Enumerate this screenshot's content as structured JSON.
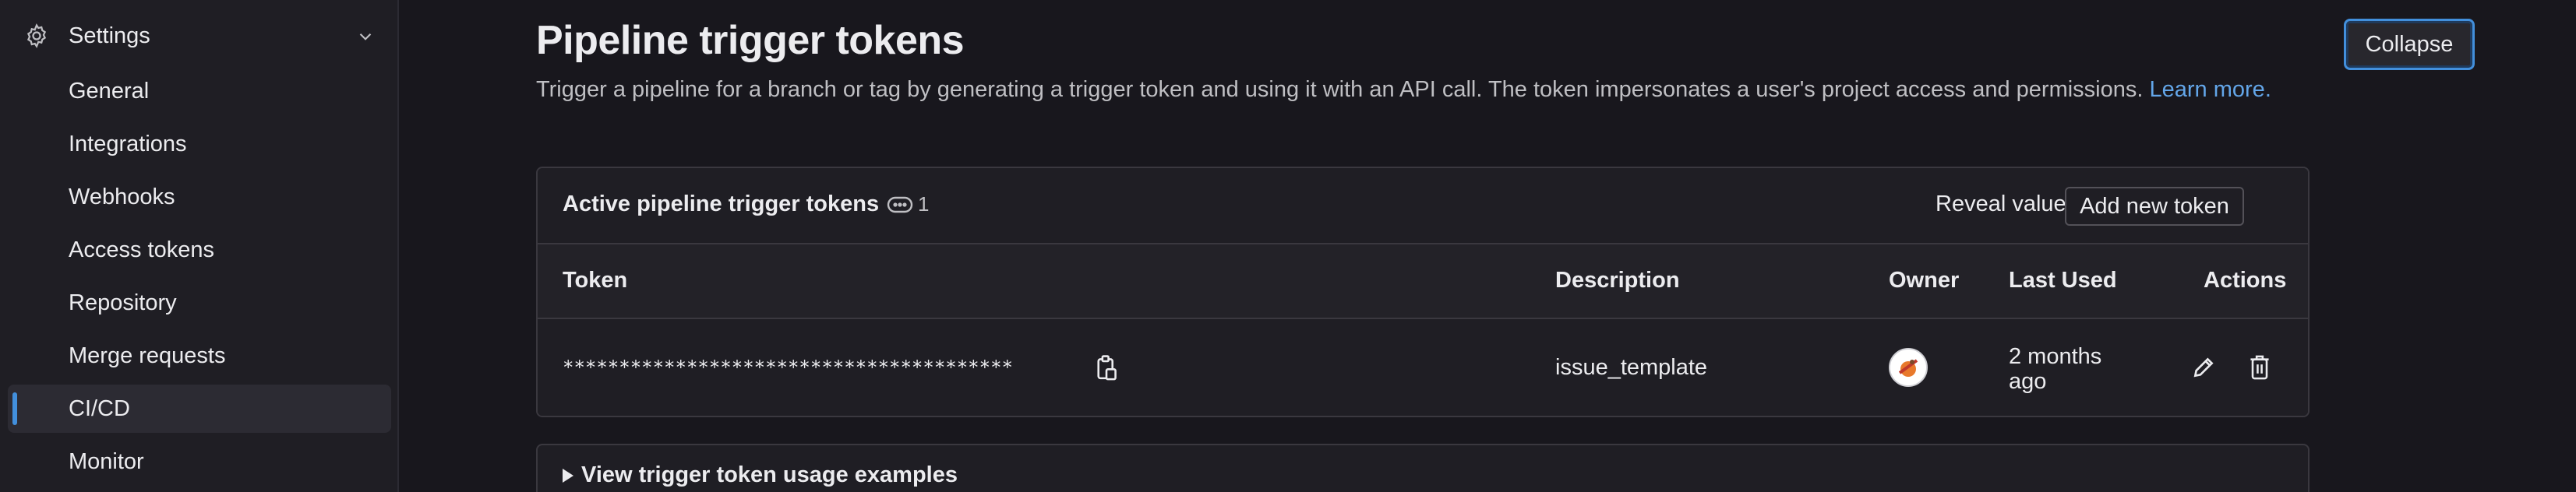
{
  "sidebar": {
    "settings_label": "Settings",
    "items": [
      {
        "label": "General"
      },
      {
        "label": "Integrations"
      },
      {
        "label": "Webhooks"
      },
      {
        "label": "Access tokens"
      },
      {
        "label": "Repository"
      },
      {
        "label": "Merge requests"
      },
      {
        "label": "CI/CD",
        "active": true
      },
      {
        "label": "Monitor"
      }
    ]
  },
  "header": {
    "title": "Pipeline trigger tokens",
    "collapse_label": "Collapse",
    "description": "Trigger a pipeline for a branch or tag by generating a trigger token and using it with an API call. The token impersonates a user's project access and permissions.",
    "learn_more": "Learn more."
  },
  "tokens_card": {
    "title": "Active pipeline trigger tokens",
    "count": "1",
    "reveal_label": "Reveal values",
    "add_label": "Add new token",
    "columns": [
      "Token",
      "Description",
      "Owner",
      "Last Used",
      "Actions"
    ],
    "rows": [
      {
        "token": "****************************************",
        "description": "issue_template",
        "last_used": "2 months ago"
      }
    ]
  },
  "examples": {
    "label": "View trigger token usage examples"
  },
  "colors": {
    "accent": "#428fdc",
    "link": "#63a6e9",
    "background": "#18171d"
  },
  "icons": [
    "gear-icon",
    "chevron-down-icon",
    "token-count-icon",
    "copy-icon",
    "avatar",
    "pencil-icon",
    "trash-icon",
    "caret-right-icon"
  ]
}
